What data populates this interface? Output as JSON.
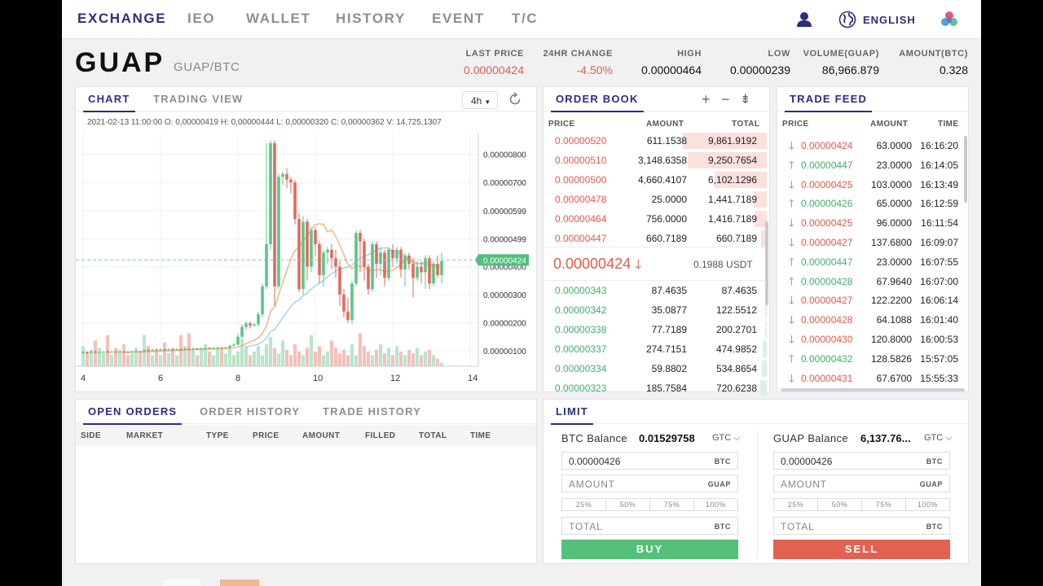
{
  "nav": {
    "items": [
      "EXCHANGE",
      "IEO",
      "WALLET",
      "HISTORY",
      "EVENT",
      "T/C"
    ],
    "active": "EXCHANGE",
    "language": "ENGLISH"
  },
  "header": {
    "symbol": "GUAP",
    "pair": "GUAP/BTC",
    "stats": [
      {
        "label": "LAST PRICE",
        "value": "0.00000424",
        "color": "red"
      },
      {
        "label": "24HR CHANGE",
        "value": "-4.50%",
        "color": "red"
      },
      {
        "label": "HIGH",
        "value": "0.00000464"
      },
      {
        "label": "LOW",
        "value": "0.00000239"
      },
      {
        "label": "VOLUME(GUAP)",
        "value": "86,966.879"
      },
      {
        "label": "AMOUNT(BTC)",
        "value": "0.328"
      }
    ]
  },
  "chart_panel": {
    "tabs": [
      "CHART",
      "TRADING VIEW"
    ],
    "interval": "4h",
    "ohlc_line": "2021-02-13 11:00:00   O: 0,00000419   H: 0,00000444   L: 0,00000320   C: 0,00000362   V: 14,725,1307"
  },
  "chart_data": {
    "type": "candlestick",
    "x_ticks": [
      "4",
      "6",
      "8",
      "10",
      "12",
      "14"
    ],
    "y_ticks": [
      "0.00000800",
      "0.00000700",
      "0.00000599",
      "0.00000499",
      "0.00000400",
      "0.00000300",
      "0.00000200",
      "0.00000100"
    ],
    "last_price_label": "0.00000424",
    "colors": {
      "up": "#5cc58a",
      "down": "#e26a5c",
      "ma1": "#e9b074",
      "ma2": "#9fcbe0",
      "vol_up": "#b9e6cb",
      "vol_down": "#f2c1bb"
    },
    "candles": [
      {
        "o": 0.94,
        "c": 0.95,
        "h": 0.99,
        "l": 0.88
      },
      {
        "o": 0.95,
        "c": 0.94,
        "h": 0.98,
        "l": 0.9
      },
      {
        "o": 0.94,
        "c": 0.96,
        "h": 1.0,
        "l": 0.92
      },
      {
        "o": 0.96,
        "c": 0.95,
        "h": 1.0,
        "l": 0.93
      },
      {
        "o": 0.95,
        "c": 0.96,
        "h": 0.98,
        "l": 0.92
      },
      {
        "o": 0.96,
        "c": 0.96,
        "h": 0.99,
        "l": 0.94
      },
      {
        "o": 0.97,
        "c": 0.95,
        "h": 1.02,
        "l": 0.93
      },
      {
        "o": 0.95,
        "c": 0.97,
        "h": 1.0,
        "l": 0.93
      },
      {
        "o": 0.97,
        "c": 0.96,
        "h": 1.01,
        "l": 0.94
      },
      {
        "o": 0.96,
        "c": 0.97,
        "h": 1.0,
        "l": 0.94
      },
      {
        "o": 0.97,
        "c": 0.96,
        "h": 0.99,
        "l": 0.93
      },
      {
        "o": 0.96,
        "c": 0.95,
        "h": 0.99,
        "l": 0.92
      },
      {
        "o": 0.95,
        "c": 0.97,
        "h": 1.0,
        "l": 0.93
      },
      {
        "o": 0.97,
        "c": 0.98,
        "h": 1.02,
        "l": 0.95
      },
      {
        "o": 0.98,
        "c": 0.97,
        "h": 1.0,
        "l": 0.95
      },
      {
        "o": 0.97,
        "c": 1.02,
        "h": 1.05,
        "l": 0.95
      },
      {
        "o": 1.02,
        "c": 1.01,
        "h": 1.06,
        "l": 0.98
      },
      {
        "o": 1.01,
        "c": 1.04,
        "h": 1.07,
        "l": 0.99
      },
      {
        "o": 1.04,
        "c": 1.03,
        "h": 1.08,
        "l": 1.0
      },
      {
        "o": 1.03,
        "c": 1.05,
        "h": 1.09,
        "l": 1.01
      },
      {
        "o": 1.05,
        "c": 1.03,
        "h": 1.08,
        "l": 1.0
      },
      {
        "o": 1.03,
        "c": 1.05,
        "h": 1.09,
        "l": 1.0
      },
      {
        "o": 1.05,
        "c": 1.04,
        "h": 1.08,
        "l": 1.01
      },
      {
        "o": 1.04,
        "c": 1.06,
        "h": 1.1,
        "l": 1.02
      },
      {
        "o": 1.06,
        "c": 1.05,
        "h": 1.08,
        "l": 1.02
      },
      {
        "o": 1.05,
        "c": 1.07,
        "h": 1.1,
        "l": 1.03
      },
      {
        "o": 1.07,
        "c": 1.06,
        "h": 1.1,
        "l": 1.04
      },
      {
        "o": 1.06,
        "c": 1.08,
        "h": 1.12,
        "l": 1.04
      },
      {
        "o": 1.08,
        "c": 1.06,
        "h": 1.11,
        "l": 1.04
      },
      {
        "o": 1.06,
        "c": 1.08,
        "h": 1.12,
        "l": 1.04
      },
      {
        "o": 1.08,
        "c": 1.1,
        "h": 1.13,
        "l": 1.05
      },
      {
        "o": 1.1,
        "c": 1.09,
        "h": 1.14,
        "l": 1.06
      },
      {
        "o": 1.09,
        "c": 1.1,
        "h": 1.13,
        "l": 1.07
      },
      {
        "o": 1.1,
        "c": 1.11,
        "h": 1.15,
        "l": 1.07
      },
      {
        "o": 1.11,
        "c": 1.1,
        "h": 1.14,
        "l": 1.07
      },
      {
        "o": 1.1,
        "c": 1.12,
        "h": 1.15,
        "l": 1.08
      },
      {
        "o": 1.12,
        "c": 1.18,
        "h": 1.22,
        "l": 1.1
      },
      {
        "o": 1.18,
        "c": 1.22,
        "h": 1.27,
        "l": 1.15
      },
      {
        "o": 1.22,
        "c": 1.5,
        "h": 1.6,
        "l": 1.2
      },
      {
        "o": 1.5,
        "c": 1.85,
        "h": 1.95,
        "l": 1.45
      },
      {
        "o": 1.85,
        "c": 1.98,
        "h": 2.05,
        "l": 1.75
      },
      {
        "o": 1.98,
        "c": 1.9,
        "h": 2.05,
        "l": 1.8
      },
      {
        "o": 1.9,
        "c": 1.94,
        "h": 2.0,
        "l": 1.86
      },
      {
        "o": 1.94,
        "c": 2.3,
        "h": 2.4,
        "l": 1.85
      },
      {
        "o": 2.3,
        "c": 3.3,
        "h": 3.4,
        "l": 2.2
      },
      {
        "o": 3.3,
        "c": 4.8,
        "h": 8.4,
        "l": 3.2
      },
      {
        "o": 4.8,
        "c": 8.4,
        "h": 8.5,
        "l": 4.6
      },
      {
        "o": 8.4,
        "c": 3.3,
        "h": 8.5,
        "l": 2.6
      },
      {
        "o": 3.3,
        "c": 7.2,
        "h": 7.3,
        "l": 3.2
      },
      {
        "o": 7.2,
        "c": 7.3,
        "h": 7.4,
        "l": 6.9
      },
      {
        "o": 7.3,
        "c": 7.1,
        "h": 7.5,
        "l": 6.8
      },
      {
        "o": 7.1,
        "c": 7.0,
        "h": 7.2,
        "l": 6.6
      },
      {
        "o": 7.0,
        "c": 5.7,
        "h": 7.1,
        "l": 5.5
      },
      {
        "o": 5.7,
        "c": 3.2,
        "h": 5.9,
        "l": 3.1
      },
      {
        "o": 3.2,
        "c": 5.6,
        "h": 5.8,
        "l": 3.0
      },
      {
        "o": 5.6,
        "c": 4.0,
        "h": 5.7,
        "l": 3.5
      },
      {
        "o": 4.0,
        "c": 5.3,
        "h": 5.4,
        "l": 3.8
      },
      {
        "o": 5.3,
        "c": 4.8,
        "h": 5.4,
        "l": 4.4
      },
      {
        "o": 4.8,
        "c": 3.7,
        "h": 4.9,
        "l": 3.4
      },
      {
        "o": 3.7,
        "c": 4.5,
        "h": 4.6,
        "l": 3.3
      },
      {
        "o": 4.5,
        "c": 4.6,
        "h": 4.7,
        "l": 4.1
      },
      {
        "o": 4.6,
        "c": 4.3,
        "h": 4.8,
        "l": 3.9
      },
      {
        "o": 4.3,
        "c": 4.0,
        "h": 4.6,
        "l": 3.6
      },
      {
        "o": 4.0,
        "c": 3.0,
        "h": 4.2,
        "l": 2.6
      },
      {
        "o": 3.0,
        "c": 2.4,
        "h": 3.2,
        "l": 2.2
      },
      {
        "o": 2.4,
        "c": 2.1,
        "h": 2.9,
        "l": 2.0
      },
      {
        "o": 2.1,
        "c": 3.4,
        "h": 3.5,
        "l": 1.95
      },
      {
        "o": 3.4,
        "c": 5.2,
        "h": 5.3,
        "l": 3.3
      },
      {
        "o": 5.2,
        "c": 4.9,
        "h": 5.3,
        "l": 3.8
      },
      {
        "o": 4.9,
        "c": 4.0,
        "h": 5.0,
        "l": 3.5
      },
      {
        "o": 4.0,
        "c": 3.2,
        "h": 4.1,
        "l": 3.0
      },
      {
        "o": 3.2,
        "c": 4.8,
        "h": 4.9,
        "l": 3.1
      },
      {
        "o": 4.8,
        "c": 4.1,
        "h": 4.9,
        "l": 3.6
      },
      {
        "o": 4.1,
        "c": 4.5,
        "h": 4.7,
        "l": 3.7
      },
      {
        "o": 4.5,
        "c": 3.6,
        "h": 4.6,
        "l": 3.3
      },
      {
        "o": 3.6,
        "c": 4.6,
        "h": 4.7,
        "l": 3.5
      },
      {
        "o": 4.6,
        "c": 4.3,
        "h": 4.8,
        "l": 4.0
      },
      {
        "o": 4.3,
        "c": 4.6,
        "h": 4.7,
        "l": 4.1
      },
      {
        "o": 4.6,
        "c": 3.9,
        "h": 4.7,
        "l": 3.6
      },
      {
        "o": 3.9,
        "c": 4.4,
        "h": 4.5,
        "l": 3.3
      },
      {
        "o": 4.4,
        "c": 4.1,
        "h": 4.5,
        "l": 3.9
      },
      {
        "o": 4.1,
        "c": 3.6,
        "h": 4.3,
        "l": 2.9
      },
      {
        "o": 3.6,
        "c": 4.0,
        "h": 4.2,
        "l": 3.5
      },
      {
        "o": 4.0,
        "c": 3.8,
        "h": 4.2,
        "l": 3.4
      },
      {
        "o": 3.8,
        "c": 4.3,
        "h": 4.4,
        "l": 3.2
      },
      {
        "o": 4.3,
        "c": 3.4,
        "h": 4.4,
        "l": 3.2
      },
      {
        "o": 3.4,
        "c": 4.1,
        "h": 4.2,
        "l": 3.3
      },
      {
        "o": 4.1,
        "c": 3.7,
        "h": 4.4,
        "l": 3.6
      },
      {
        "o": 3.7,
        "c": 4.2,
        "h": 4.5,
        "l": 3.4
      }
    ],
    "volumes": [
      0.55,
      0.4,
      0.45,
      0.7,
      0.5,
      0.35,
      0.85,
      0.3,
      0.5,
      0.45,
      0.6,
      0.3,
      0.35,
      0.5,
      0.4,
      0.85,
      0.55,
      0.3,
      0.45,
      0.3,
      0.65,
      0.35,
      0.5,
      0.3,
      0.85,
      0.55,
      0.9,
      0.45,
      0.3,
      0.5,
      0.6,
      0.4,
      0.3,
      0.5,
      0.45,
      0.35,
      0.55,
      0.3,
      0.4,
      0.75,
      0.55,
      0.3,
      0.4,
      0.55,
      0.3,
      0.6,
      0.8,
      0.5,
      0.35,
      0.7,
      0.45,
      0.3,
      0.6,
      0.4,
      0.3,
      0.5,
      0.85,
      0.4,
      0.55,
      0.3,
      0.4,
      0.7,
      0.5,
      0.35,
      0.45,
      0.3,
      0.6,
      0.3,
      0.9,
      0.55,
      0.4,
      0.3,
      0.45,
      0.6,
      0.35,
      0.5,
      0.3,
      0.55,
      0.4,
      0.3,
      0.45,
      0.35,
      0.5,
      0.3,
      0.4,
      0.45,
      0.3,
      0.2,
      0.1
    ]
  },
  "order_book": {
    "title": "ORDER BOOK",
    "columns": [
      "PRICE",
      "AMOUNT",
      "TOTAL"
    ],
    "asks": [
      {
        "price": "0.00000520",
        "amount": "611.1538",
        "total": "9,861.9192",
        "depth": 0.99
      },
      {
        "price": "0.00000510",
        "amount": "3,148.6358",
        "total": "9,250.7654",
        "depth": 0.93
      },
      {
        "price": "0.00000500",
        "amount": "4,660.4107",
        "total": "6,102.1296",
        "depth": 0.62
      },
      {
        "price": "0.00000478",
        "amount": "25.0000",
        "total": "1,441.7189",
        "depth": 0.15
      },
      {
        "price": "0.00000464",
        "amount": "756.0000",
        "total": "1,416.7189",
        "depth": 0.14
      },
      {
        "price": "0.00000447",
        "amount": "660.7189",
        "total": "660.7189",
        "depth": 0.07
      }
    ],
    "mid_price": "0.00000424",
    "mid_usdt": "0.1988 USDT",
    "bids": [
      {
        "price": "0.00000343",
        "amount": "87.4635",
        "total": "87.4635",
        "depth": 0.01
      },
      {
        "price": "0.00000342",
        "amount": "35.0877",
        "total": "122.5512",
        "depth": 0.015
      },
      {
        "price": "0.00000338",
        "amount": "77.7189",
        "total": "200.2701",
        "depth": 0.02
      },
      {
        "price": "0.00000337",
        "amount": "274.7151",
        "total": "474.9852",
        "depth": 0.05
      },
      {
        "price": "0.00000334",
        "amount": "59.8802",
        "total": "534.8654",
        "depth": 0.055
      },
      {
        "price": "0.00000323",
        "amount": "185.7584",
        "total": "720.6238",
        "depth": 0.075
      }
    ]
  },
  "trade_feed": {
    "title": "TRADE FEED",
    "columns": [
      "PRICE",
      "AMOUNT",
      "TIME"
    ],
    "trades": [
      {
        "dir": "down",
        "price": "0.00000424",
        "amount": "63.0000",
        "time": "16:16:20"
      },
      {
        "dir": "up",
        "price": "0.00000447",
        "amount": "23.0000",
        "time": "16:14:05"
      },
      {
        "dir": "down",
        "price": "0.00000425",
        "amount": "103.0000",
        "time": "16:13:49"
      },
      {
        "dir": "up",
        "price": "0.00000426",
        "amount": "65.0000",
        "time": "16:12:59"
      },
      {
        "dir": "down",
        "price": "0.00000425",
        "amount": "96.0000",
        "time": "16:11:54"
      },
      {
        "dir": "down",
        "price": "0.00000427",
        "amount": "137.6800",
        "time": "16:09:07"
      },
      {
        "dir": "up",
        "price": "0.00000447",
        "amount": "23.0000",
        "time": "16:07:55"
      },
      {
        "dir": "up",
        "price": "0.00000428",
        "amount": "67.9640",
        "time": "16:07:00"
      },
      {
        "dir": "down",
        "price": "0.00000427",
        "amount": "122.2200",
        "time": "16:06:14"
      },
      {
        "dir": "down",
        "price": "0.00000428",
        "amount": "64.1088",
        "time": "16:01:40"
      },
      {
        "dir": "down",
        "price": "0.00000430",
        "amount": "120.8000",
        "time": "16:00:53"
      },
      {
        "dir": "up",
        "price": "0.00000432",
        "amount": "128.5826",
        "time": "15:57:05"
      },
      {
        "dir": "down",
        "price": "0.00000431",
        "amount": "67.6700",
        "time": "15:55:33"
      }
    ]
  },
  "orders_panel": {
    "tabs": [
      "OPEN ORDERS",
      "ORDER HISTORY",
      "TRADE HISTORY"
    ],
    "columns": [
      "SIDE",
      "MARKET",
      "TYPE",
      "PRICE",
      "AMOUNT",
      "FILLED",
      "TOTAL",
      "TIME"
    ]
  },
  "limit_panel": {
    "tab": "LIMIT",
    "buy": {
      "balance_label": "BTC Balance",
      "balance_value": "0.01529758",
      "selector": "GTC",
      "price": "0.00000426",
      "price_unit": "BTC",
      "amount_placeholder": "AMOUNT",
      "amount_unit": "GUAP",
      "percents": [
        "25%",
        "50%",
        "75%",
        "100%"
      ],
      "total_placeholder": "TOTAL",
      "total_unit": "BTC",
      "button": "BUY"
    },
    "sell": {
      "balance_label": "GUAP Balance",
      "balance_value": "6,137.76...",
      "selector": "GTC",
      "price": "0.00000426",
      "price_unit": "BTC",
      "amount_placeholder": "AMOUNT",
      "amount_unit": "GUAP",
      "percents": [
        "25%",
        "50%",
        "75%",
        "100%"
      ],
      "total_placeholder": "TOTAL",
      "total_unit": "BTC",
      "button": "SELL"
    }
  }
}
